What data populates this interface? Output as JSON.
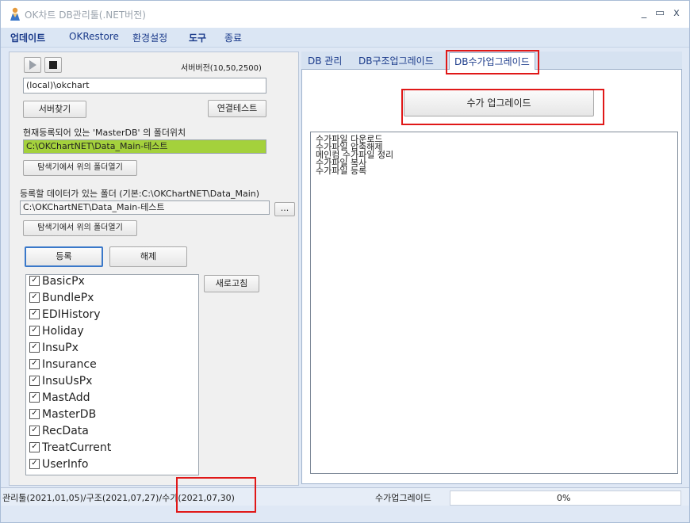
{
  "window": {
    "title": "OK차트 DB관리툴(.NET버전)",
    "controls": {
      "minimize": "_",
      "maximize": "▭",
      "close": "x"
    }
  },
  "menu": [
    {
      "label": "업데이트",
      "bold": true
    },
    {
      "label": "OKRestore",
      "bold": false
    },
    {
      "label": "환경설정",
      "bold": false
    },
    {
      "label": "도구",
      "bold": true
    },
    {
      "label": "종료",
      "bold": false
    }
  ],
  "left": {
    "server_version": "서버버전(10,50,2500)",
    "server_name": "(local)\\okchart",
    "find_server": "서버찾기",
    "connection_test": "연결테스트",
    "masterdb_label": "현재등록되어 있는 'MasterDB' 의 폴더위치",
    "masterdb_path": "C:\\OKChartNET\\Data_Main-테스트",
    "open_folder_1": "탐색기에서 위의 폴더열기",
    "data_folder_label": "등록할 데이터가 있는 폴더 (기본:C:\\OKChartNET\\Data_Main)",
    "data_folder_path": "C:\\OKChartNET\\Data_Main-테스트",
    "browse": "...",
    "open_folder_2": "탐색기에서 위의 폴더열기",
    "register": "등록",
    "unregister": "해제",
    "refresh": "새로고침",
    "databases": [
      "BasicPx",
      "BundlePx",
      "EDIHistory",
      "Holiday",
      "InsuPx",
      "Insurance",
      "InsuUsPx",
      "MastAdd",
      "MasterDB",
      "RecData",
      "TreatCurrent",
      "UserInfo"
    ]
  },
  "tabs": [
    {
      "label": "DB 관리",
      "active": false
    },
    {
      "label": "DB구조업그레이드",
      "active": false
    },
    {
      "label": "DB수가업그레이드",
      "active": true
    }
  ],
  "right": {
    "upgrade_button": "수가 업그레이드",
    "log": [
      "수가파일 다운로드",
      "수가파일 압축해제",
      "메인컴 수가파일 정리",
      "수가파일 복사",
      "수가파일 등록"
    ]
  },
  "status": {
    "versions": "관리툴(2021,01,05)/구조(2021,07,27)/수가(2021,07,30)",
    "task": "수가업그레이드",
    "progress_text": "0%",
    "progress": 0
  },
  "colors": {
    "highlight_path": "#a4d13c",
    "annotation": "#e01818"
  }
}
